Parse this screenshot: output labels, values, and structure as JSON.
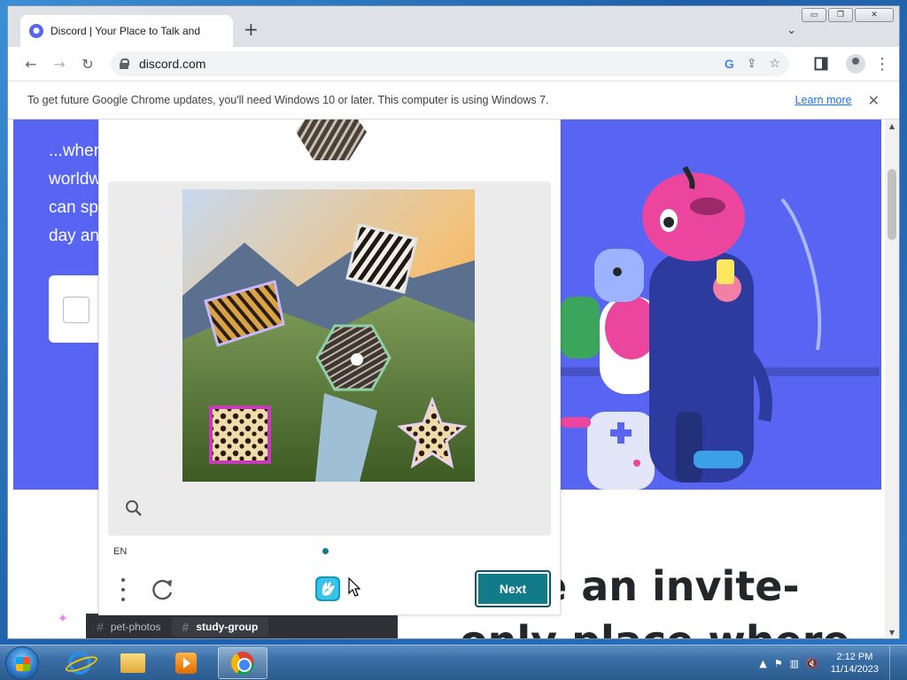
{
  "window": {
    "minimize": "▭",
    "restore": "❐",
    "close": "✕"
  },
  "tab": {
    "title": "Discord | Your Place to Talk and H",
    "close": "✕",
    "new_tab": "+",
    "search_tabs": "⌄"
  },
  "toolbar": {
    "back": "←",
    "forward": "→",
    "reload": "↻",
    "url": "discord.com",
    "google": "G",
    "share": "⇪",
    "bookmark": "☆",
    "menu": "⋮"
  },
  "infobar": {
    "message": "To get future Google Chrome updates, you'll need Windows 10 or later. This computer is using Windows 7.",
    "learn_more": "Learn more",
    "close": "✕"
  },
  "page": {
    "hero_lines": [
      "...wher",
      "worldw",
      "can sp",
      "day an"
    ],
    "headline_1": "e an invite-",
    "headline_2": "only place where",
    "channels": [
      {
        "hash": "#",
        "name": "pet-photos"
      },
      {
        "hash": "#",
        "name": "study-group"
      }
    ],
    "sparkle": "✦"
  },
  "captcha": {
    "language": "EN",
    "next_label": "Next"
  },
  "scrollbar": {
    "up": "▲",
    "down": "▼"
  },
  "taskbar": {
    "clock_time": "2:12 PM",
    "clock_date": "11/14/2023",
    "tray_arrow": "▲",
    "tray_flag": "⚑",
    "tray_network": "▥",
    "tray_volume": "🔇"
  },
  "colors": {
    "discord_blurple": "#5865f2",
    "hcaptcha_teal": "#127b8a",
    "link_blue": "#1a73e8"
  }
}
